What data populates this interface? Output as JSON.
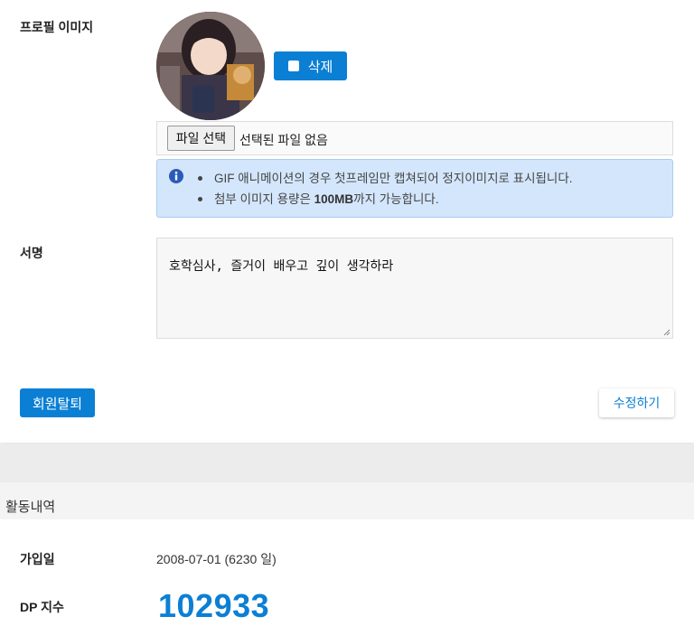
{
  "profile": {
    "image_label": "프로필 이미지",
    "delete_label": "삭제",
    "file_button": "파일 선택",
    "file_status": "선택된 파일 없음",
    "info_lines": [
      "GIF 애니메이션의 경우 첫프레임만 캡쳐되어 정지이미지로 표시됩니다.",
      "첨부 이미지 용량은 ",
      "100MB",
      "까지 가능합니다."
    ]
  },
  "signature": {
    "label": "서명",
    "text": "호학심사, 즐거이 배우고 깊이 생각하라"
  },
  "actions": {
    "withdraw": "회원탈퇴",
    "edit": "수정하기"
  },
  "activity": {
    "title": "활동내역",
    "join_label": "가입일",
    "join_value": "2008-07-01 (6230 일)",
    "dp_label": "DP 지수",
    "dp_value": "102933"
  },
  "colors": {
    "accent": "#0b7fd4",
    "info_bg": "#d4e6fc"
  }
}
